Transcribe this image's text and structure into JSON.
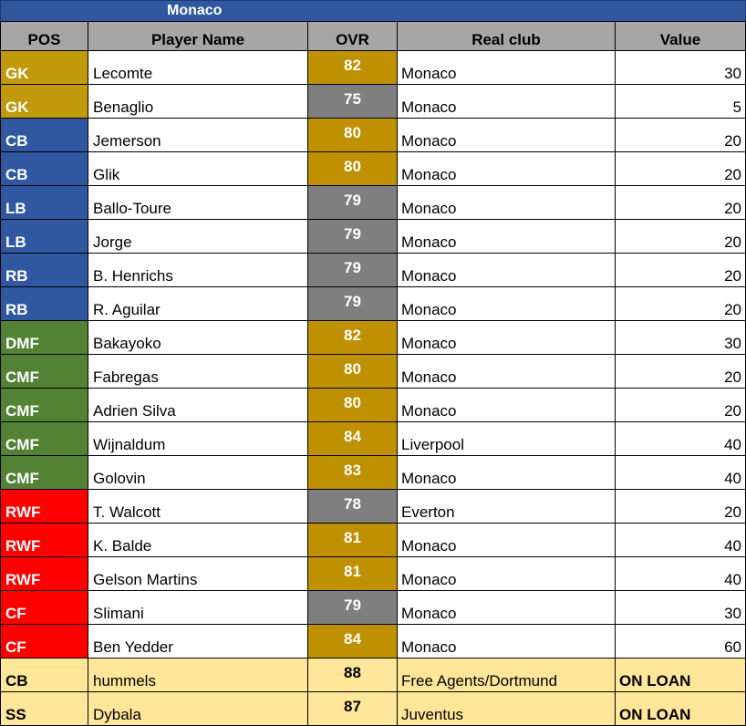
{
  "team": "Monaco",
  "headers": [
    "POS",
    "Player Name",
    "OVR",
    "Real  club",
    "Value"
  ],
  "rows": [
    {
      "pos": "GK",
      "group": "gk",
      "name": "Lecomte",
      "ovr": "82",
      "tier": "gold",
      "club": "Monaco",
      "value": "30"
    },
    {
      "pos": "GK",
      "group": "gk",
      "name": "Benaglio",
      "ovr": "75",
      "tier": "grey",
      "club": "Monaco",
      "value": "5"
    },
    {
      "pos": "CB",
      "group": "def",
      "name": "Jemerson",
      "ovr": "80",
      "tier": "gold",
      "club": "Monaco",
      "value": "20"
    },
    {
      "pos": "CB",
      "group": "def",
      "name": "Glik",
      "ovr": "80",
      "tier": "gold",
      "club": "Monaco",
      "value": "20"
    },
    {
      "pos": "LB",
      "group": "def",
      "name": "Ballo-Toure",
      "ovr": "79",
      "tier": "grey",
      "club": "Monaco",
      "value": "20"
    },
    {
      "pos": "LB",
      "group": "def",
      "name": "Jorge",
      "ovr": "79",
      "tier": "grey",
      "club": "Monaco",
      "value": "20"
    },
    {
      "pos": "RB",
      "group": "def",
      "name": "B. Henrichs",
      "ovr": "79",
      "tier": "grey",
      "club": "Monaco",
      "value": "20"
    },
    {
      "pos": "RB",
      "group": "def",
      "name": "R. Aguilar",
      "ovr": "79",
      "tier": "grey",
      "club": "Monaco",
      "value": "20"
    },
    {
      "pos": "DMF",
      "group": "mid",
      "name": "Bakayoko",
      "ovr": "82",
      "tier": "gold",
      "club": "Monaco",
      "value": "30"
    },
    {
      "pos": "CMF",
      "group": "mid",
      "name": "Fabregas",
      "ovr": "80",
      "tier": "gold",
      "club": "Monaco",
      "value": "20"
    },
    {
      "pos": "CMF",
      "group": "mid",
      "name": "Adrien Silva",
      "ovr": "80",
      "tier": "gold",
      "club": "Monaco",
      "value": "20"
    },
    {
      "pos": "CMF",
      "group": "mid",
      "name": "Wijnaldum",
      "ovr": "84",
      "tier": "gold",
      "club": "Liverpool",
      "value": "40"
    },
    {
      "pos": "CMF",
      "group": "mid",
      "name": "Golovin",
      "ovr": "83",
      "tier": "gold",
      "club": "Monaco",
      "value": "40"
    },
    {
      "pos": "RWF",
      "group": "att",
      "name": "T. Walcott",
      "ovr": "78",
      "tier": "grey",
      "club": "Everton",
      "value": "20"
    },
    {
      "pos": "RWF",
      "group": "att",
      "name": "K. Balde",
      "ovr": "81",
      "tier": "gold",
      "club": "Monaco",
      "value": "40"
    },
    {
      "pos": "RWF",
      "group": "att",
      "name": "Gelson Martins",
      "ovr": "81",
      "tier": "gold",
      "club": "Monaco",
      "value": "40"
    },
    {
      "pos": "CF",
      "group": "att",
      "name": "Slimani",
      "ovr": "79",
      "tier": "grey",
      "club": "Monaco",
      "value": "30"
    },
    {
      "pos": "CF",
      "group": "att",
      "name": "Ben Yedder",
      "ovr": "84",
      "tier": "gold",
      "club": "Monaco",
      "value": "60"
    },
    {
      "pos": "CB",
      "group": "loan",
      "name": "hummels",
      "ovr": "88",
      "tier": "loan",
      "club": "Free Agents/Dortmund",
      "value": "ON LOAN"
    },
    {
      "pos": "SS",
      "group": "loan",
      "name": "Dybala",
      "ovr": "87",
      "tier": "loan",
      "club": "Juventus",
      "value": "ON LOAN"
    }
  ],
  "colors": {
    "title_bg": "#2f58a0",
    "header_bg": "#a6a6a6",
    "gk": "#c09a0a",
    "defender": "#2f58a0",
    "midfielder": "#548235",
    "attacker": "#ff0000",
    "ovr_gold": "#bf9000",
    "ovr_grey": "#7f7f7f",
    "loan_bg": "#ffe699"
  }
}
